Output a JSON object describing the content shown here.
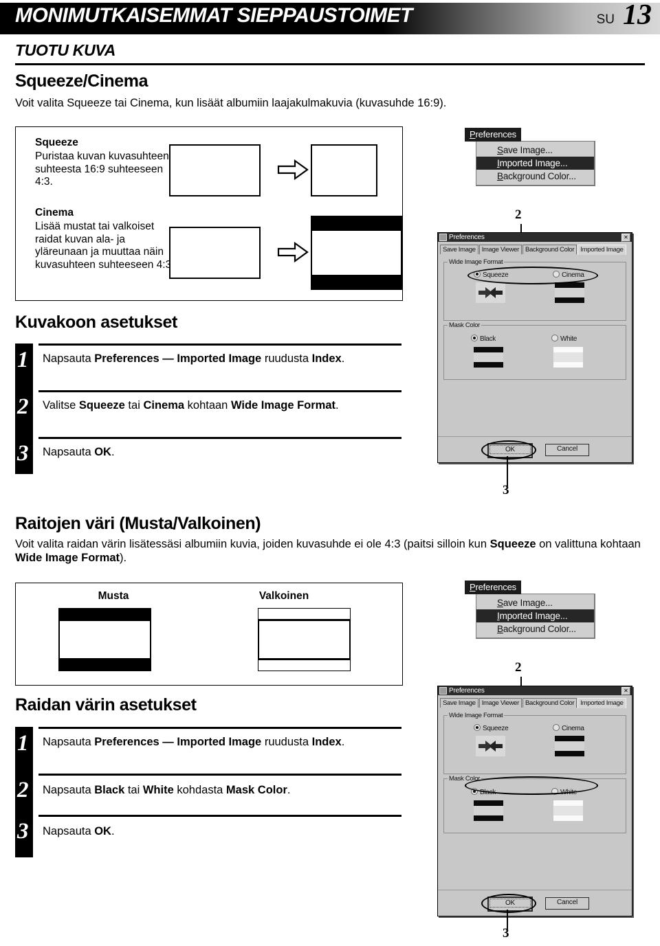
{
  "header": {
    "title": "MONIMUTKAISEMMAT SIEPPAUSTOIMET",
    "lang_code": "SU",
    "page_number": "13",
    "subtitle": "TUOTU KUVA"
  },
  "sections": {
    "squeeze_cinema": {
      "title": "Squeeze/Cinema",
      "intro": "Voit valita Squeeze tai Cinema, kun lisäät albumiin laajakulmakuvia (kuvasuhde 16:9).",
      "squeeze_label": "Squeeze",
      "squeeze_desc": "Puristaa kuvan kuvasuhteen suhteesta 16:9 suhteeseen 4:3.",
      "cinema_label": "Cinema",
      "cinema_desc": "Lisää mustat tai valkoiset raidat kuvan ala- ja yläreunaan ja muuttaa näin kuvasuhteen suhteeseen 4:3.",
      "arrow_icon": "right-arrow-outline"
    },
    "image_size_steps": {
      "title": "Kuvakoon asetukset",
      "steps": [
        {
          "num": "1",
          "text": "Napsauta Preferences — Imported Image ruudusta Index."
        },
        {
          "num": "2",
          "text": "Valitse Squeeze tai Cinema kohtaan Wide Image Format."
        },
        {
          "num": "3",
          "text": "Napsauta OK."
        }
      ]
    },
    "mask_color": {
      "title": "Raitojen väri (Musta/Valkoinen)",
      "intro": "Voit valita raidan värin lisätessäsi albumiin kuvia, joiden kuvasuhde ei ole 4:3 (paitsi silloin kun Squeeze on valittuna kohtaan Wide Image Format).",
      "black_label": "Musta",
      "white_label": "Valkoinen"
    },
    "mask_color_steps": {
      "title": "Raidan värin asetukset",
      "steps": [
        {
          "num": "1",
          "text": "Napsauta Preferences — Imported Image ruudusta Index."
        },
        {
          "num": "2",
          "text": "Napsauta Black tai White kohdasta Mask Color."
        },
        {
          "num": "3",
          "text": "Napsauta OK."
        }
      ]
    }
  },
  "menu": {
    "title": "Preferences",
    "items": [
      "Save Image...",
      "Imported Image...",
      "Background Color..."
    ],
    "selected_index": 1
  },
  "dialog": {
    "title": "Preferences",
    "window_icon": "app-icon",
    "close_icon": "close-x-icon",
    "tabs": [
      "Save Image",
      "Image Viewer",
      "Background Color",
      "Imported Image"
    ],
    "active_tab": "Imported Image",
    "wide_image_format": {
      "group_label": "Wide Image Format",
      "options": [
        "Squeeze",
        "Cinema"
      ],
      "selected": "Squeeze",
      "squeeze_icon": "squeeze-arrows-icon"
    },
    "mask_color": {
      "group_label": "Mask Color",
      "options": [
        "Black",
        "White"
      ],
      "selected": "Black"
    },
    "buttons": {
      "ok": "OK",
      "cancel": "Cancel"
    }
  },
  "callouts": {
    "two": "2",
    "three": "3"
  }
}
